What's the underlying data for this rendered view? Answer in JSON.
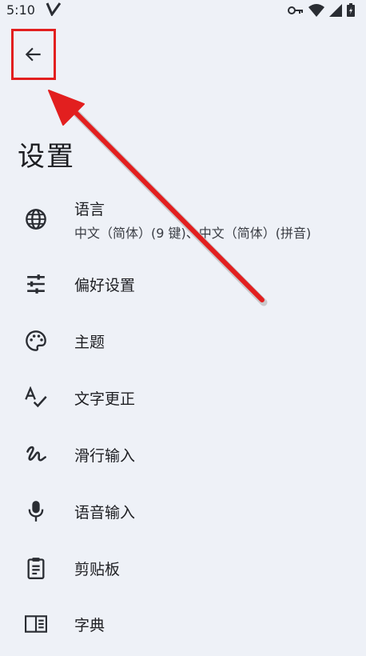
{
  "status_bar": {
    "time": "5:10"
  },
  "header": {
    "title": "设置"
  },
  "settings": {
    "language": {
      "label": "语言",
      "subtitle": "中文（简体）(9 键)、中文（简体）(拼音)"
    },
    "preferences": {
      "label": "偏好设置"
    },
    "theme": {
      "label": "主题"
    },
    "text_correction": {
      "label": "文字更正"
    },
    "glide_typing": {
      "label": "滑行输入"
    },
    "voice_input": {
      "label": "语音输入"
    },
    "clipboard": {
      "label": "剪贴板"
    },
    "dictionary": {
      "label": "字典"
    }
  },
  "icons": {
    "back": "arrow-left-icon",
    "language": "globe-icon",
    "preferences": "tune-sliders-icon",
    "theme": "palette-icon",
    "text_correction": "spellcheck-icon",
    "glide_typing": "gesture-icon",
    "voice_input": "microphone-icon",
    "clipboard": "clipboard-icon",
    "dictionary": "book-icon"
  },
  "colors": {
    "background": "#eef1f7",
    "annotation_red": "#e21f1f",
    "text": "#1d1f24"
  }
}
